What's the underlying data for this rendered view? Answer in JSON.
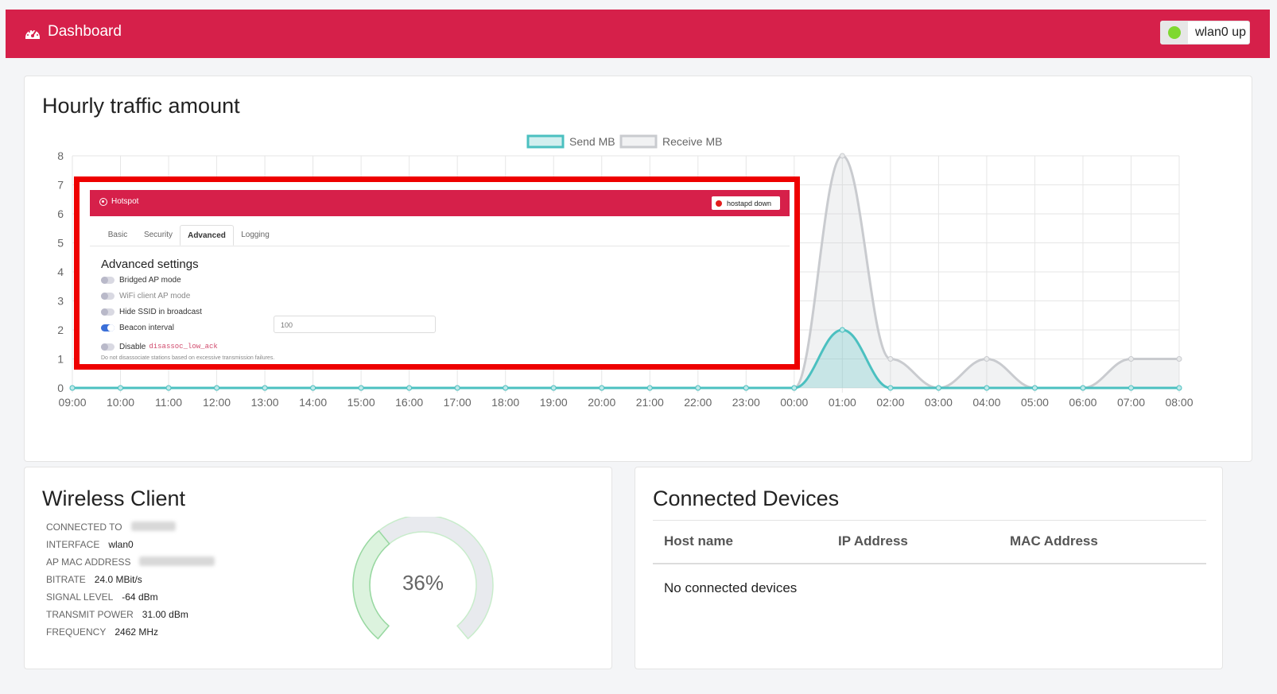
{
  "header": {
    "title": "Dashboard",
    "status": "wlan0 up",
    "status_color": "#7fd82f",
    "brand_color": "#d6204a"
  },
  "traffic": {
    "title": "Hourly traffic amount",
    "legend": {
      "send": "Send MB",
      "receive": "Receive MB"
    }
  },
  "chart_data": {
    "type": "area",
    "title": "Hourly traffic amount",
    "x": [
      "09:00",
      "10:00",
      "11:00",
      "12:00",
      "13:00",
      "14:00",
      "15:00",
      "16:00",
      "17:00",
      "18:00",
      "19:00",
      "20:00",
      "21:00",
      "22:00",
      "23:00",
      "00:00",
      "01:00",
      "02:00",
      "03:00",
      "04:00",
      "05:00",
      "06:00",
      "07:00",
      "08:00"
    ],
    "series": [
      {
        "name": "Send MB",
        "color": "#4bc0c0",
        "values": [
          0,
          0,
          0,
          0,
          0,
          0,
          0,
          0,
          0,
          0,
          0,
          0,
          0,
          0,
          0,
          0,
          2,
          0,
          0,
          0,
          0,
          0,
          0,
          0
        ]
      },
      {
        "name": "Receive MB",
        "color": "#c9cbcf",
        "values": [
          0,
          0,
          0,
          0,
          0,
          0,
          0,
          0,
          0,
          0,
          0,
          0,
          0,
          0,
          0,
          0,
          8,
          1,
          0,
          1,
          0,
          0,
          1,
          1
        ]
      }
    ],
    "ylim": [
      0,
      8
    ],
    "yticks": [
      0,
      1,
      2,
      3,
      4,
      5,
      6,
      7,
      8
    ],
    "grid": true,
    "legend_position": "top"
  },
  "overlay": {
    "title": "Hotspot",
    "status": "hostapd down",
    "tabs": [
      "Basic",
      "Security",
      "Advanced",
      "Logging"
    ],
    "active_tab": "Advanced",
    "heading": "Advanced settings",
    "options": [
      {
        "label": "Bridged AP mode",
        "on": false
      },
      {
        "label": "WiFi client AP mode",
        "on": false
      },
      {
        "label": "Hide SSID in broadcast",
        "on": false
      },
      {
        "label": "Beacon interval",
        "on": true
      },
      {
        "label": "Disable",
        "on": false,
        "code": "disassoc_low_ack"
      }
    ],
    "beacon_value": "100",
    "hint": "Do not disassociate stations based on excessive transmission failures."
  },
  "wireless": {
    "title": "Wireless Client",
    "rows": [
      {
        "label": "CONNECTED TO",
        "value": ""
      },
      {
        "label": "INTERFACE",
        "value": "wlan0"
      },
      {
        "label": "AP MAC ADDRESS",
        "value": ""
      },
      {
        "label": "BITRATE",
        "value": "24.0 MBit/s"
      },
      {
        "label": "SIGNAL LEVEL",
        "value": "-64 dBm"
      },
      {
        "label": "TRANSMIT POWER",
        "value": "31.00 dBm"
      },
      {
        "label": "FREQUENCY",
        "value": "2462 MHz"
      }
    ],
    "signal_percent": 36,
    "gauge_text": "36%"
  },
  "devices": {
    "title": "Connected Devices",
    "columns": [
      "Host name",
      "IP Address",
      "MAC Address"
    ],
    "empty": "No connected devices"
  }
}
